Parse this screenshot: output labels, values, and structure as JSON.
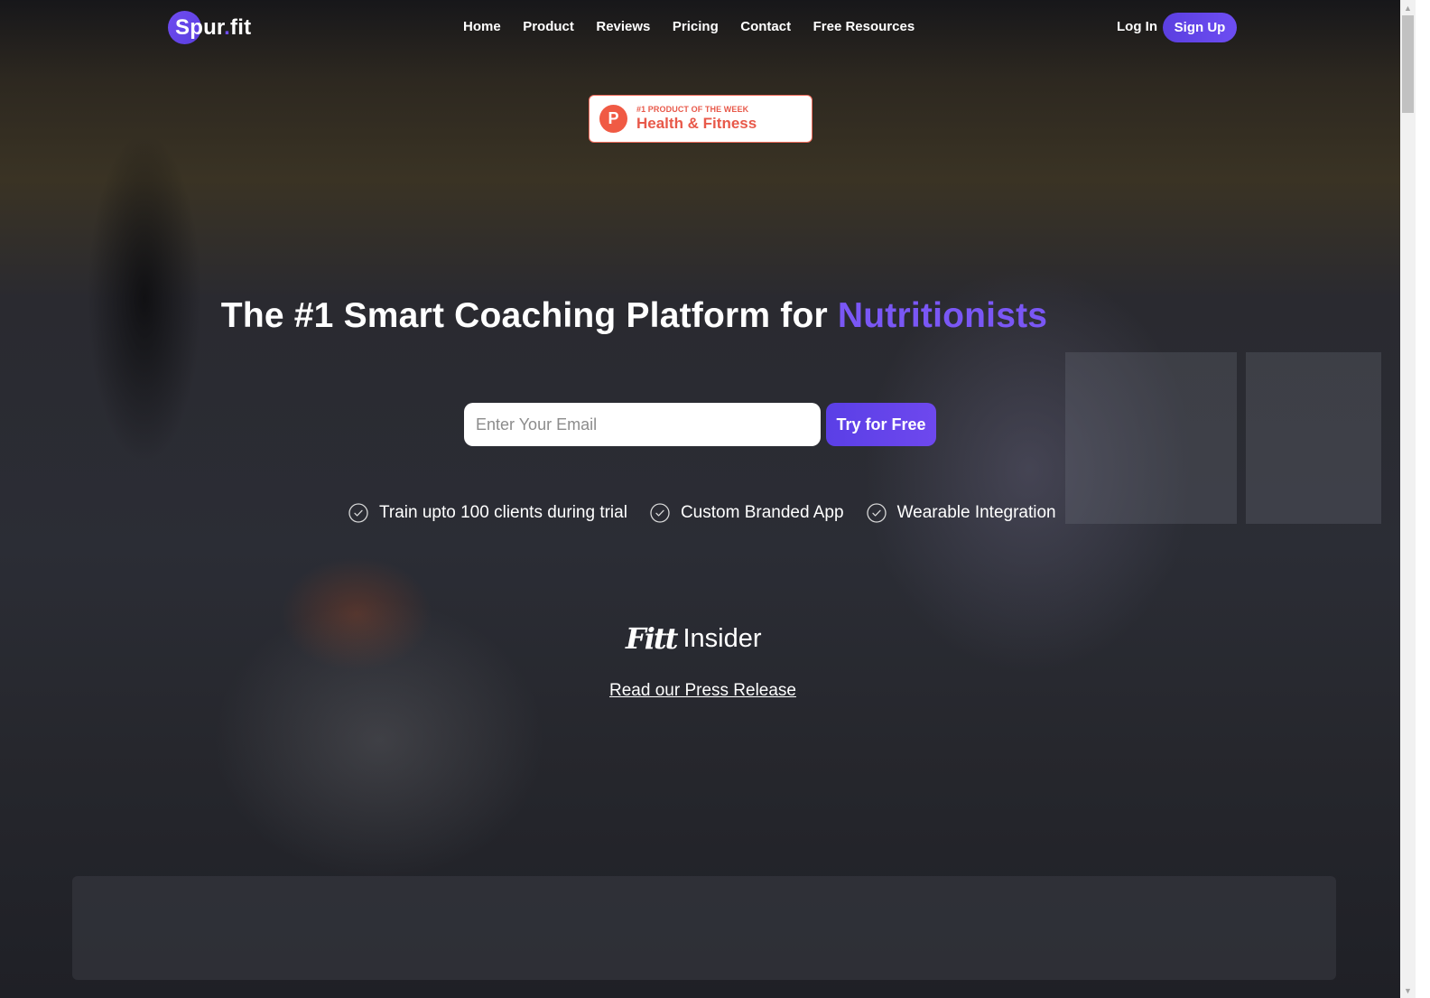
{
  "brand": {
    "name_main": "Spur",
    "name_dot": ".",
    "name_suffix": "fit",
    "accent_color": "#6d4df2"
  },
  "nav": {
    "links": [
      {
        "label": "Home"
      },
      {
        "label": "Product"
      },
      {
        "label": "Reviews"
      },
      {
        "label": "Pricing"
      },
      {
        "label": "Contact"
      },
      {
        "label": "Free Resources"
      }
    ],
    "login_label": "Log In",
    "signup_label": "Sign Up"
  },
  "badge": {
    "icon_letter": "P",
    "small_text": "#1 PRODUCT OF THE WEEK",
    "big_text": "Health & Fitness",
    "color": "#e8594a"
  },
  "hero": {
    "headline_prefix": "The #1 Smart Coaching Platform for ",
    "headline_accent": "Nutritionists",
    "email_placeholder": "Enter Your Email",
    "email_value": "",
    "cta_label": "Try for Free",
    "features": [
      {
        "icon": "check-circle-icon",
        "label": "Train upto 100 clients during trial"
      },
      {
        "icon": "check-circle-icon",
        "label": "Custom Branded App"
      },
      {
        "icon": "check-circle-icon",
        "label": "Wearable Integration"
      }
    ]
  },
  "press": {
    "logo_script": "Fitt",
    "logo_word": "Insider",
    "link_label": "Read our Press Release"
  },
  "scrollbar": {
    "up_glyph": "▲",
    "down_glyph": "▼"
  }
}
